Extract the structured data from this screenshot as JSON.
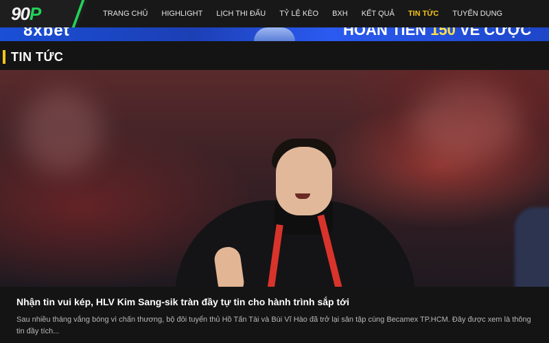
{
  "header": {
    "logo_text": "90",
    "logo_accent": "P",
    "nav": [
      {
        "label": "TRANG CHỦ",
        "active": false
      },
      {
        "label": "HIGHLIGHT",
        "active": false
      },
      {
        "label": "LỊCH THI ĐẤU",
        "active": false
      },
      {
        "label": "TỶ LỆ KÈO",
        "active": false
      },
      {
        "label": "BXH",
        "active": false
      },
      {
        "label": "KẾT QUẢ",
        "active": false
      },
      {
        "label": "TIN TỨC",
        "active": true
      },
      {
        "label": "TUYỂN DỤNG",
        "active": false
      }
    ]
  },
  "banner": {
    "brand": "8xbet",
    "promo_prefix": "HOÀN TIỀN",
    "promo_highlight": "150",
    "promo_suffix": "VỀ CƯỢC"
  },
  "section": {
    "title": "TIN TỨC"
  },
  "article": {
    "title": "Nhận tin vui kép, HLV Kim Sang-sik tràn đầy tự tin cho hành trình sắp tới",
    "excerpt": "Sau nhiều tháng vắng bóng vì chấn thương, bộ đôi tuyển thủ Hồ Tấn Tài và Bùi Vĩ Hào đã trở lại sân tập cùng Becamex TP.HCM. Đây được xem là thông tin đầy tích..."
  },
  "colors": {
    "accent_green": "#23d25a",
    "active_nav": "#f5c518",
    "background": "#141414"
  }
}
